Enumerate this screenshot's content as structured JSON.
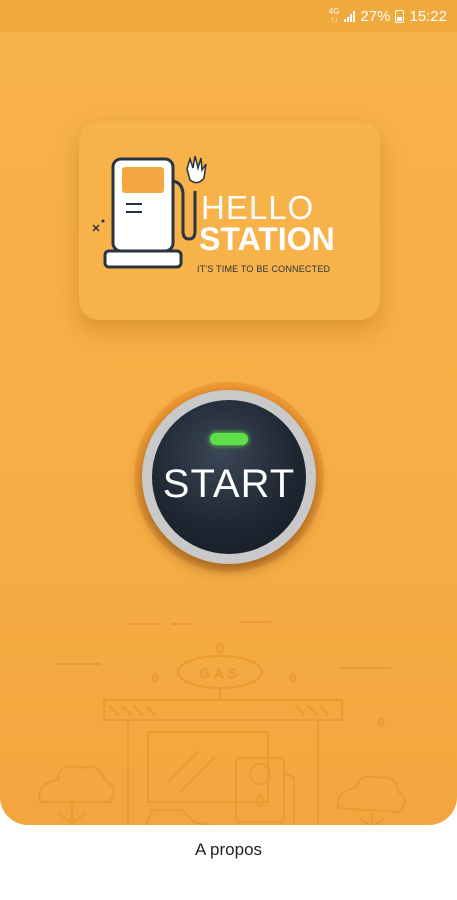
{
  "status_bar": {
    "network": "4G",
    "battery_percent": "27%",
    "time": "15:22"
  },
  "logo": {
    "line1": "HELLO",
    "line2": "STATION",
    "tagline": "IT'S TIME TO BE CONNECTED"
  },
  "start_button": {
    "label": "START"
  },
  "scene": {
    "sign_text": "GAS"
  },
  "footer": {
    "about_link": "A propos"
  },
  "colors": {
    "primary_orange": "#f6ad45",
    "button_dark": "#1f2733",
    "led_green": "#5fe04a",
    "line_art": "#e99a33"
  }
}
